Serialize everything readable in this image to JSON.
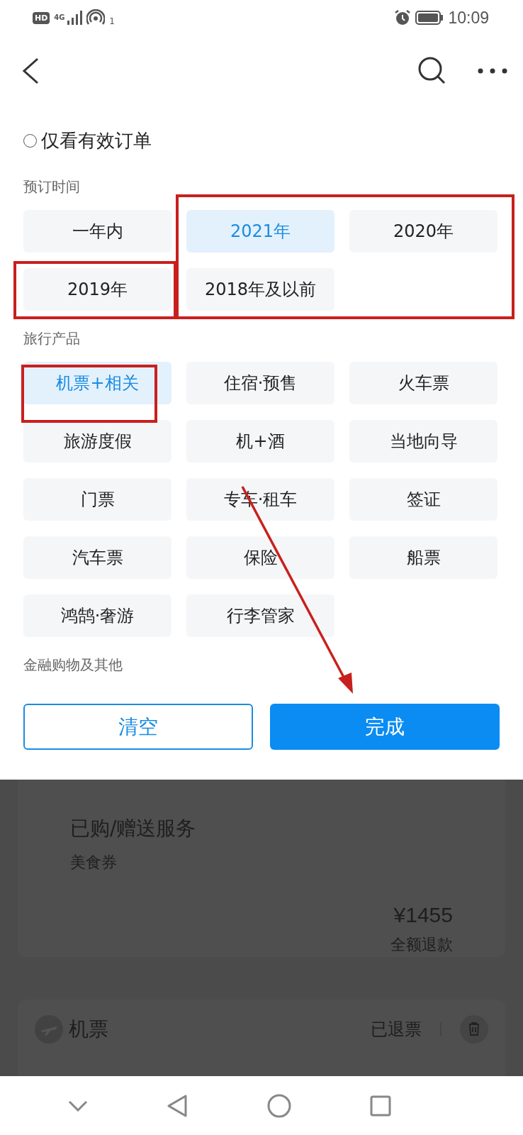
{
  "status_bar": {
    "sim_badge": "HD",
    "network": "4G",
    "hotspot_count": "1",
    "time": "10:09"
  },
  "valid_only": {
    "label": "仅看有效订单",
    "checked": false
  },
  "sections": [
    {
      "title": "预订时间",
      "options": [
        {
          "label": "一年内",
          "selected": false
        },
        {
          "label": "2021年",
          "selected": true
        },
        {
          "label": "2020年",
          "selected": false
        },
        {
          "label": "2019年",
          "selected": false
        },
        {
          "label": "2018年及以前",
          "selected": false
        }
      ]
    },
    {
      "title": "旅行产品",
      "options": [
        {
          "label": "机票+相关",
          "selected": true
        },
        {
          "label": "住宿·预售",
          "selected": false
        },
        {
          "label": "火车票",
          "selected": false
        },
        {
          "label": "旅游度假",
          "selected": false
        },
        {
          "label": "机+酒",
          "selected": false
        },
        {
          "label": "当地向导",
          "selected": false
        },
        {
          "label": "门票",
          "selected": false
        },
        {
          "label": "专车·租车",
          "selected": false
        },
        {
          "label": "签证",
          "selected": false
        },
        {
          "label": "汽车票",
          "selected": false
        },
        {
          "label": "保险",
          "selected": false
        },
        {
          "label": "船票",
          "selected": false
        },
        {
          "label": "鸿鹄·奢游",
          "selected": false
        },
        {
          "label": "行李管家",
          "selected": false
        }
      ]
    },
    {
      "title": "金融购物及其他"
    }
  ],
  "buttons": {
    "clear": "清空",
    "done": "完成"
  },
  "background_order": {
    "services_title": "已购/赠送服务",
    "service": "美食券",
    "price": "¥1455",
    "refund": "全额退款",
    "product": "机票",
    "status": "已退票"
  }
}
